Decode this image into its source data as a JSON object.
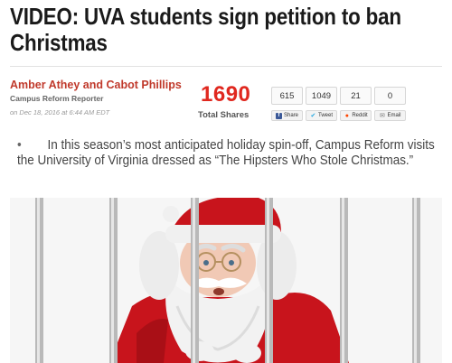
{
  "article": {
    "headline": "VIDEO: UVA students sign petition to ban Christmas",
    "author": "Amber Athey and Cabot Phillips",
    "author_role": "Campus Reform Reporter",
    "date": "on Dec 18, 2016 at 6:44 AM EDT",
    "summary": "In this season’s most anticipated holiday spin-off, Campus Reform visits the University of Virginia dressed as “The Hipsters Who Stole Christmas.”",
    "bullet": "•"
  },
  "shares": {
    "total": "1690",
    "total_label": "Total Shares",
    "buttons": [
      {
        "count": "615",
        "label": "Share",
        "icon": "facebook-icon"
      },
      {
        "count": "1049",
        "label": "Tweet",
        "icon": "twitter-icon"
      },
      {
        "count": "21",
        "label": "Reddit",
        "icon": "reddit-icon"
      },
      {
        "count": "0",
        "label": "Email",
        "icon": "email-icon"
      }
    ]
  },
  "colors": {
    "author": "#c0392b",
    "total_count": "#e0281f",
    "facebook": "#3b5998",
    "twitter": "#2aa9e0",
    "reddit": "#ff4500"
  },
  "image": {
    "subject": "santa-behind-bars-image"
  }
}
